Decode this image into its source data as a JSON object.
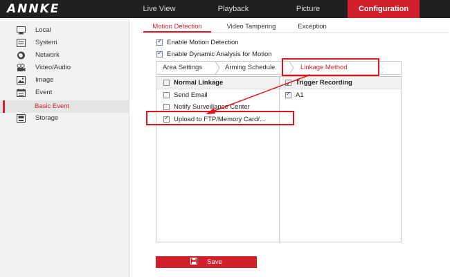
{
  "header": {
    "logo": "ANNKE",
    "nav": [
      {
        "label": "Live View",
        "active": false
      },
      {
        "label": "Playback",
        "active": false
      },
      {
        "label": "Picture",
        "active": false
      },
      {
        "label": "Configuration",
        "active": true
      }
    ]
  },
  "sidebar": {
    "items": [
      {
        "label": "Local",
        "icon": "monitor-icon"
      },
      {
        "label": "System",
        "icon": "system-icon"
      },
      {
        "label": "Network",
        "icon": "globe-icon"
      },
      {
        "label": "Video/Audio",
        "icon": "video-icon"
      },
      {
        "label": "Image",
        "icon": "image-icon"
      },
      {
        "label": "Event",
        "icon": "calendar-icon"
      },
      {
        "label": "Basic Event",
        "selected": true
      },
      {
        "label": "Storage",
        "icon": "storage-icon"
      }
    ]
  },
  "tabs": [
    {
      "label": "Motion Detection",
      "active": true
    },
    {
      "label": "Video Tampering",
      "active": false
    },
    {
      "label": "Exception",
      "active": false
    }
  ],
  "options": {
    "enable_motion": {
      "label": "Enable Motion Detection",
      "checked": true
    },
    "enable_dynamic": {
      "label": "Enable Dynamic Analysis for Motion",
      "checked": true
    }
  },
  "subtabs": [
    {
      "label": "Area Settings",
      "active": false
    },
    {
      "label": "Arming Schedule",
      "active": false
    },
    {
      "label": "Linkage Method",
      "active": true
    }
  ],
  "linkage": {
    "normal_header": "Normal Linkage",
    "normal_items": [
      {
        "label": "Send Email",
        "checked": false
      },
      {
        "label": "Notify Surveillance Center",
        "checked": false
      },
      {
        "label": "Upload to FTP/Memory Card/...",
        "checked": true
      }
    ],
    "trigger_header": "Trigger Recording",
    "trigger_items": [
      {
        "label": "A1",
        "checked": true
      }
    ]
  },
  "save_label": "Save",
  "colors": {
    "accent": "#d21f2c",
    "annotation": "#e3131b",
    "topbar": "#202020"
  }
}
